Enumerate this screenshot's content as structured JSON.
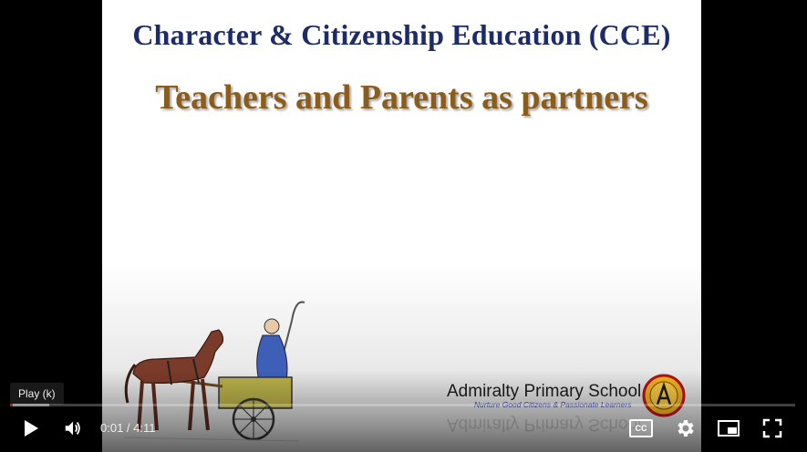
{
  "video": {
    "slide_title": "Character & Citizenship Education (CCE)",
    "slide_subtitle": "Teachers and Parents as partners",
    "school_name": "Admiralty Primary School",
    "school_tagline": "Nurture Good Citizens & Passionate Learners",
    "title_color": "#1d2c66",
    "subtitle_color": "#8a5d1c"
  },
  "player": {
    "tooltip": "Play (k)",
    "current_time": "0:01",
    "time_separator": " / ",
    "duration": "4:11",
    "progress_played_fraction": 0.004,
    "progress_loaded_fraction": 0.05,
    "accent_color": "#ff0000",
    "icons": {
      "play": "play-icon",
      "volume": "volume-icon",
      "captions": "captions-icon",
      "settings": "settings-gear-icon",
      "miniplayer": "miniplayer-icon",
      "fullscreen": "fullscreen-icon"
    },
    "captions_label": "CC"
  }
}
